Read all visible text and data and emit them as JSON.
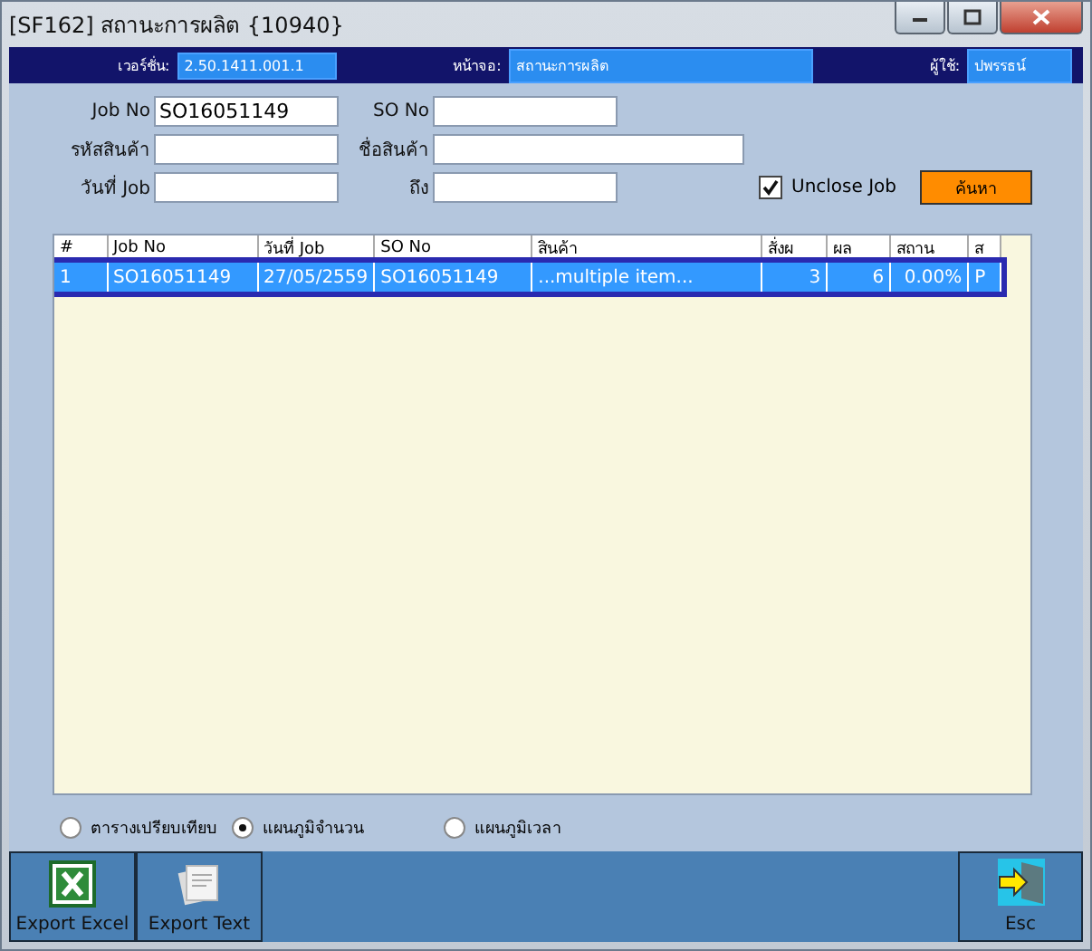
{
  "window": {
    "title": "[SF162] สถานะการผลิต {10940}"
  },
  "info_bar": [
    {
      "label": "เวอร์ชั่น:",
      "value": "2.50.1411.001.1"
    },
    {
      "label": "หน้าจอ:",
      "value": "สถานะการผลิต"
    },
    {
      "label": "ผู้ใช้:",
      "value": "ปพรรธน์"
    }
  ],
  "form_rows": [
    [
      {
        "label": "Job No",
        "value": "SO16051149"
      },
      {
        "label": "SO No"
      }
    ],
    [
      {
        "label": "รหัสสินค้า"
      },
      {
        "label": "ชื่อสินค้า",
        "wide": true
      }
    ],
    [
      {
        "label": "วันที่ Job"
      },
      {
        "label": "ถึง"
      }
    ]
  ],
  "unclose_job": {
    "label": "Unclose Job",
    "checked": true
  },
  "search_button": "ค้นหา",
  "table": {
    "columns": [
      "#",
      "Job No",
      "วันที่ Job",
      "SO No",
      "สินค้า",
      "สั่งผ",
      "ผล",
      "สถาน",
      "ส"
    ],
    "rows": [
      {
        "cells": [
          "1",
          "SO16051149",
          "27/05/2559",
          "SO16051149",
          "...multiple item...",
          "3",
          "6",
          "0.00%",
          "P"
        ],
        "selected": true
      }
    ]
  },
  "chart_options": [
    {
      "label": "ตารางเปรียบเทียบ",
      "selected": false
    },
    {
      "label": "แผนภูมิจำนวน",
      "selected": true
    },
    {
      "label": "แผนภูมิเวลา",
      "selected": false
    }
  ],
  "footer_buttons": [
    {
      "label": "Export Excel",
      "kind": "excel"
    },
    {
      "label": "Export Text",
      "kind": "text"
    },
    {
      "label": "Esc",
      "kind": "exit"
    }
  ]
}
